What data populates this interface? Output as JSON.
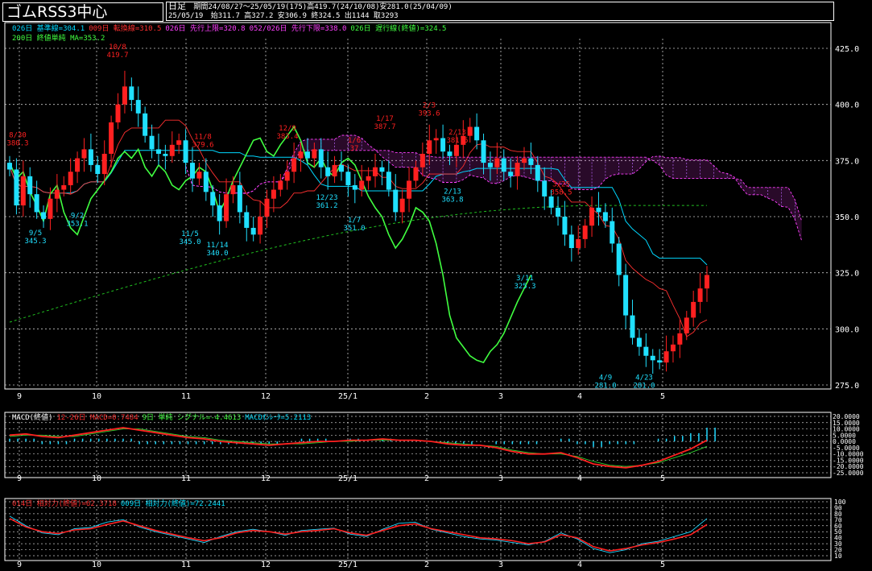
{
  "header": {
    "title": "ゴムRSS3中心",
    "period_type": "日足",
    "period_info": "期間24/08/27〜25/05/19(175)高419.7(24/10/08)安281.0(25/04/09)",
    "date": "25/05/19",
    "ohlc": "始311.7 高327.2 安306.9 終324.5 出1144 取3293"
  },
  "legend": {
    "line1": [
      {
        "text": "026日 基準線=304.1",
        "color": "#00d8ff"
      },
      {
        "text": "009日 転換線=310.5",
        "color": "#ff3030"
      },
      {
        "text": "026日 先行上限=320.8",
        "color": "#ff40ff"
      },
      {
        "text": "052/026日 先行下限=338.0",
        "color": "#ff40ff"
      },
      {
        "text": "026日 遅行線(終値)=324.5",
        "color": "#40ff40"
      }
    ],
    "line2": [
      {
        "text": "200日 終値単純 MA=353.2",
        "color": "#40ff40"
      }
    ],
    "macd": [
      {
        "text": "MACD(終値)",
        "color": "#ffffff"
      },
      {
        "text": "12-26日 MACD=0.7484",
        "color": "#ff3030"
      },
      {
        "text": "9日 単純 シグナル=-4.4613",
        "color": "#40ff40"
      },
      {
        "text": "MACDｵｼﾚｰﾀ=5.2113",
        "color": "#00e0ff"
      }
    ],
    "rsi": [
      {
        "text": "014日 相対力(終値)=62.3718",
        "color": "#ff3030"
      },
      {
        "text": "009日 相対力(終値)=72.2441",
        "color": "#00e0ff"
      }
    ]
  },
  "colors": {
    "up": "#ff2020",
    "down": "#20e0ff",
    "kijun": "#00d8ff",
    "tenkan": "#ff3030",
    "cloud": "#ff40ff",
    "chikou": "#40ff40",
    "ma200": "#20c020",
    "grid": "#c8c8c8"
  },
  "chart_data": [
    {
      "type": "candlestick",
      "title": "ゴムRSS3中心",
      "ylim": [
        275,
        425
      ],
      "y_ticks": [
        "425.0",
        "400.0",
        "375.0",
        "350.0",
        "325.0",
        "300.0",
        "275.0"
      ],
      "x_ticks": [
        "9",
        "10",
        "11",
        "12",
        "25/1",
        "2",
        "3",
        "4",
        "5"
      ],
      "close_approx": [
        371,
        355,
        368,
        360,
        352,
        349,
        358,
        362,
        364,
        370,
        376,
        380,
        373,
        369,
        378,
        392,
        400,
        408,
        402,
        396,
        386,
        380,
        378,
        377,
        382,
        384,
        374,
        367,
        370,
        361,
        355,
        348,
        360,
        364,
        352,
        345,
        342,
        350,
        358,
        362,
        366,
        370,
        376,
        379,
        376,
        380,
        372,
        368,
        373,
        370,
        364,
        362,
        366,
        368,
        372,
        370,
        362,
        352,
        358,
        366,
        372,
        378,
        384,
        385,
        379,
        377,
        382,
        386,
        390,
        384,
        374,
        372,
        376,
        370,
        368,
        374,
        376,
        373,
        366,
        359,
        354,
        350,
        342,
        336,
        340,
        346,
        354,
        352,
        348,
        338,
        324,
        306,
        296,
        292,
        288,
        286,
        285,
        290,
        293,
        298,
        305,
        312,
        318,
        324
      ],
      "annotations": [
        {
          "label": "8/30",
          "value": "380.3"
        },
        {
          "label": "9/5",
          "value": "345.3"
        },
        {
          "label": "9/2",
          "value": "353.1"
        },
        {
          "label": "10/8",
          "value": "419.7"
        },
        {
          "label": "11/8",
          "value": "379.6"
        },
        {
          "label": "11/5",
          "value": "345.0"
        },
        {
          "label": "11/14",
          "value": "340.0"
        },
        {
          "label": "12/9",
          "value": "383.4"
        },
        {
          "label": "12/23",
          "value": "361.2"
        },
        {
          "label": "1/6",
          "value": "37"
        },
        {
          "label": "1/7",
          "value": "351.0"
        },
        {
          "label": "1/17",
          "value": "387.7"
        },
        {
          "label": "2/3",
          "value": "393.6"
        },
        {
          "label": "2/13",
          "value": "381.5"
        },
        {
          "label": "2/13",
          "value": "363.8"
        },
        {
          "label": "3/25",
          "value": "358.5"
        },
        {
          "label": "3/11",
          "value": "325.3"
        },
        {
          "label": "4/9",
          "value": "281.0"
        },
        {
          "label": "4/23",
          "value": "281.0"
        }
      ]
    },
    {
      "type": "line",
      "title": "MACD(終値)",
      "ylim": [
        -25,
        20
      ],
      "y_ticks": [
        "20.0000",
        "15.0000",
        "10.0000",
        "5.0000",
        "0.0000",
        "-5.0000",
        "-10.0000",
        "-15.0000",
        "-20.0000",
        "-25.0000"
      ],
      "x_ticks": [
        "9",
        "10",
        "11",
        "12",
        "25/1",
        "2",
        "3",
        "4",
        "5"
      ],
      "macd_approx": [
        5,
        6,
        4,
        3,
        5,
        7,
        9,
        11,
        9,
        7,
        5,
        3,
        2,
        0,
        -1,
        -2,
        -3,
        -2,
        -1,
        0,
        0,
        1,
        1,
        2,
        1,
        1,
        0,
        -2,
        -3,
        -3,
        -5,
        -8,
        -10,
        -10,
        -9,
        -13,
        -18,
        -20,
        -21,
        -19,
        -16,
        -11,
        -6,
        1
      ],
      "signal_approx": [
        4,
        5,
        5,
        4,
        4,
        6,
        8,
        10,
        10,
        8,
        6,
        4,
        3,
        1,
        0,
        -1,
        -2,
        -2,
        -2,
        -1,
        0,
        0,
        1,
        1,
        1,
        1,
        0,
        -1,
        -2,
        -3,
        -4,
        -7,
        -9,
        -10,
        -10,
        -12,
        -16,
        -19,
        -20,
        -19,
        -17,
        -13,
        -9,
        -4
      ]
    },
    {
      "type": "line",
      "title": "相対力(終値)",
      "ylim": [
        10,
        100
      ],
      "y_ticks": [
        "100",
        "90",
        "80",
        "70",
        "60",
        "50",
        "40",
        "30",
        "20",
        "10"
      ],
      "x_ticks": [
        "9",
        "10",
        "11",
        "12",
        "25/1",
        "2",
        "3",
        "4",
        "5"
      ],
      "rsi14_approx": [
        72,
        58,
        50,
        47,
        53,
        55,
        62,
        68,
        60,
        52,
        46,
        40,
        35,
        40,
        48,
        52,
        50,
        46,
        50,
        52,
        55,
        48,
        44,
        52,
        60,
        63,
        55,
        50,
        45,
        40,
        38,
        35,
        30,
        33,
        45,
        40,
        25,
        18,
        22,
        28,
        32,
        38,
        45,
        62
      ],
      "rsi9_approx": [
        76,
        60,
        48,
        45,
        55,
        57,
        66,
        70,
        58,
        50,
        44,
        38,
        32,
        42,
        50,
        54,
        50,
        44,
        52,
        54,
        56,
        46,
        42,
        54,
        64,
        66,
        54,
        48,
        42,
        38,
        36,
        32,
        28,
        34,
        48,
        38,
        22,
        15,
        20,
        30,
        34,
        42,
        50,
        72
      ]
    }
  ]
}
